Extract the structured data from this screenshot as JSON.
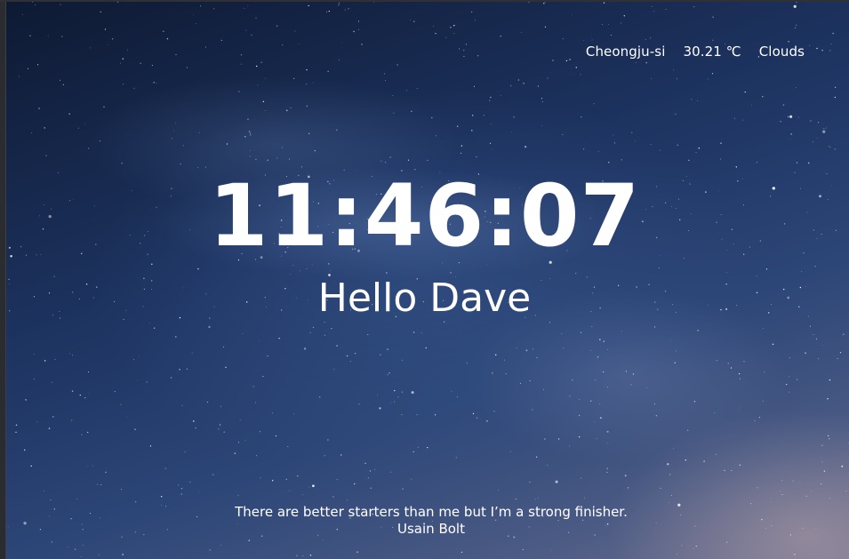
{
  "weather": {
    "city": "Cheongju-si",
    "temperature": "30.21 ℃",
    "condition": "Clouds"
  },
  "clock": {
    "time": "11:46:07"
  },
  "greeting": {
    "text": "Hello Dave"
  },
  "quote": {
    "text": "There are better starters than me but I’m a strong finisher.",
    "author": "Usain Bolt"
  },
  "colors": {
    "text": "#ffffff",
    "sky_dark": "#0e1a33",
    "sky_mid": "#2c4677"
  }
}
